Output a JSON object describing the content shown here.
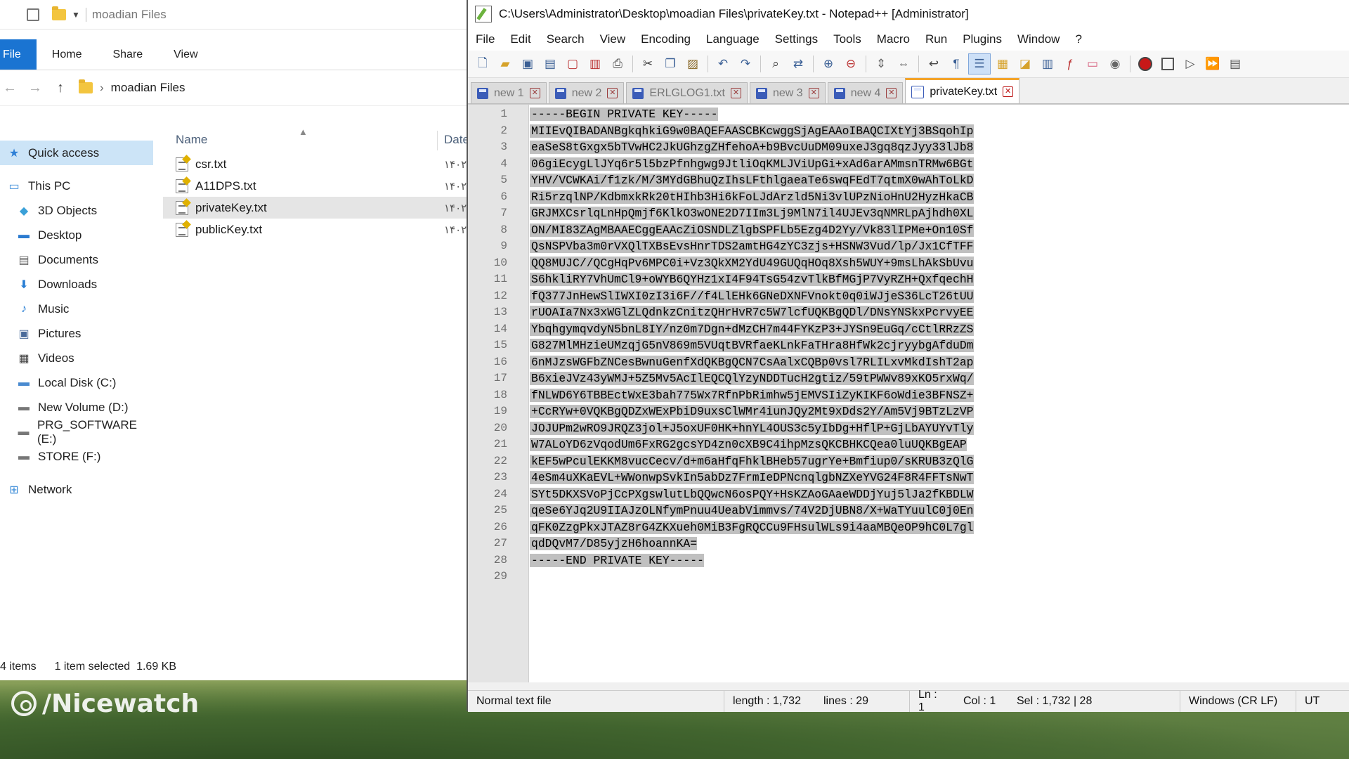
{
  "explorer": {
    "path_title": "moadian Files",
    "ribbon": [
      "File",
      "Home",
      "Share",
      "View"
    ],
    "address": "moadian Files",
    "column_name": "Name",
    "column_date": "Date",
    "nav": [
      {
        "label": "Quick access",
        "icon": "star-icon",
        "top": true,
        "selected": true
      },
      {
        "label": "This PC",
        "icon": "computer-icon",
        "top": true
      },
      {
        "label": "3D Objects",
        "icon": "cube-icon"
      },
      {
        "label": "Desktop",
        "icon": "desktop-icon"
      },
      {
        "label": "Documents",
        "icon": "document-icon"
      },
      {
        "label": "Downloads",
        "icon": "download-icon"
      },
      {
        "label": "Music",
        "icon": "music-icon"
      },
      {
        "label": "Pictures",
        "icon": "picture-icon"
      },
      {
        "label": "Videos",
        "icon": "video-icon"
      },
      {
        "label": "Local Disk (C:)",
        "icon": "drive-icon"
      },
      {
        "label": "New Volume (D:)",
        "icon": "drive-icon"
      },
      {
        "label": "PRG_SOFTWARE (E:)",
        "icon": "drive-icon"
      },
      {
        "label": "STORE (F:)",
        "icon": "drive-icon"
      },
      {
        "label": "Network",
        "icon": "network-icon",
        "top": true
      }
    ],
    "files": [
      {
        "name": "csr.txt",
        "date": "۱۴۰۲/"
      },
      {
        "name": "A11DPS.txt",
        "date": "۱۴۰۲/"
      },
      {
        "name": "privateKey.txt",
        "date": "۱۴۰۲/",
        "selected": true
      },
      {
        "name": "publicKey.txt",
        "date": "۱۴۰۲/"
      }
    ],
    "status_items": "4 items",
    "status_selected": "1 item selected  1.69 KB"
  },
  "npp": {
    "title": "C:\\Users\\Administrator\\Desktop\\moadian Files\\privateKey.txt - Notepad++ [Administrator]",
    "menu": [
      "File",
      "Edit",
      "Search",
      "View",
      "Encoding",
      "Language",
      "Settings",
      "Tools",
      "Macro",
      "Run",
      "Plugins",
      "Window",
      "?"
    ],
    "tabs": [
      {
        "label": "new 1"
      },
      {
        "label": "new 2"
      },
      {
        "label": "ERLGLOG1.txt"
      },
      {
        "label": "new 3"
      },
      {
        "label": "new 4"
      },
      {
        "label": "privateKey.txt",
        "active": true
      }
    ],
    "lines": [
      "-----BEGIN PRIVATE KEY-----",
      "MIIEvQIBADANBgkqhkiG9w0BAQEFAASCBKcwggSjAgEAAoIBAQCIXtYj3BSqohIp",
      "eaSeS8tGxgx5bTVwHC2JkUGhzgZHfehoA+b9BvcUuDM09uxeJ3gq8qzJyy33lJb8",
      "06giEcygLlJYq6r5l5bzPfnhgwg9JtliOqKMLJViUpGi+xAd6arAMmsnTRMw6BGt",
      "YHV/VCWKAi/f1zk/M/3MYdGBhuQzIhsLFthlgaeaTe6swqFEdT7qtmX0wAhToLkD",
      "Ri5rzqlNP/KdbmxkRk20tHIhb3Hi6kFoLJdArzld5Ni3vlUPzNioHnU2HyzHkaCB",
      "GRJMXCsrlqLnHpQmjf6KlkO3wONE2D7IIm3Lj9MlN7il4UJEv3qNMRLpAjhdh0XL",
      "ON/MI83ZAgMBAAECggEAAcZiOSNDLZlgbSPFLb5Ezg4D2Yy/Vk83lIPMe+On10Sf",
      "QsNSPVba3m0rVXQlTXBsEvsHnrTDS2amtHG4zYC3zjs+HSNW3Vud/lp/Jx1CfTFF",
      "QQ8MUJC//QCgHqPv6MPC0i+Vz3QkXM2YdU49GUQqHOq8Xsh5WUY+9msLhAkSbUvu",
      "S6hkliRY7VhUmCl9+oWYB6QYHz1xI4F94TsG54zvTlkBfMGjP7VyRZH+QxfqechH",
      "fQ377JnHewSlIWXI0zI3i6F//f4LlEHk6GNeDXNFVnokt0q0iWJjeS36LcT26tUU",
      "rUOAIa7Nx3xWGlZLQdnkzCnitzQHrHvR7c5W7lcfUQKBgQDl/DNsYNSkxPcrvyEE",
      "YbqhgymqvdyN5bnL8IY/nz0m7Dgn+dMzCH7m44FYKzP3+JYSn9EuGq/cCtlRRzZS",
      "G827MlMHzieUMzqjG5nV869m5VUqtBVRfaeKLnkFaTHra8HfWk2cjryybgAfduDm",
      "6nMJzsWGFbZNCesBwnuGenfXdQKBgQCN7CsAalxCQBp0vsl7RLILxvMkdIshT2ap",
      "B6xieJVz43yWMJ+5Z5Mv5AcIlEQCQlYzyNDDTucH2gtiz/59tPWWv89xKO5rxWq/",
      "fNLWD6Y6TBBEctWxE3bah775Wx7RfnPbRimhw5jEMVSIiZyKIKF6oWdie3BFNSZ+",
      "+CcRYw+0VQKBgQDZxWExPbiD9uxsClWMr4iunJQy2Mt9xDds2Y/Am5Vj9BTzLzVP",
      "JOJUPm2wRO9JRQZ3jol+J5oxUF0HK+hnYL4OUS3c5yIbDg+HflP+GjLbAYUYvTly",
      "W7ALoYD6zVqodUm6FxRG2gcsYD4zn0cXB9C4ihpMzsQKCBHKCQea0luUQKBgEAP",
      "kEF5wPculEKKM8vucCecv/d+m6aHfqFhklBHeb57ugrYe+Bmfiup0/sKRUB3zQlG",
      "4eSm4uXKaEVL+WWonwpSvkIn5abDz7FrmIeDPNcnqlgbNZXeYVG24F8R4FFTsNwT",
      "SYt5DKXSVoPjCcPXgswlutLbQQwcN6osPQY+HsKZAoGAaeWDDjYuj5lJa2fKBDLW",
      "qeSe6YJq2U9IIAJzOLNfymPnuu4UeabVimmvs/74V2DjUBN8/X+WaTYuulC0j0En",
      "qFK0ZzgPkxJTAZ8rG4ZKXueh0MiB3FgRQCCu9FHsulWLs9i4aaMBQeOP9hC0L7gl",
      "qdDQvM7/D85yjzH6hoannKA=",
      "-----END PRIVATE KEY-----",
      ""
    ],
    "status": {
      "type": "Normal text file",
      "length": "length : 1,732",
      "lines": "lines : 29",
      "ln": "Ln : 1",
      "col": "Col : 1",
      "sel": "Sel : 1,732 | 28",
      "eol": "Windows (CR LF)",
      "enc": "UT"
    }
  },
  "watermark": "/Nicewatch"
}
